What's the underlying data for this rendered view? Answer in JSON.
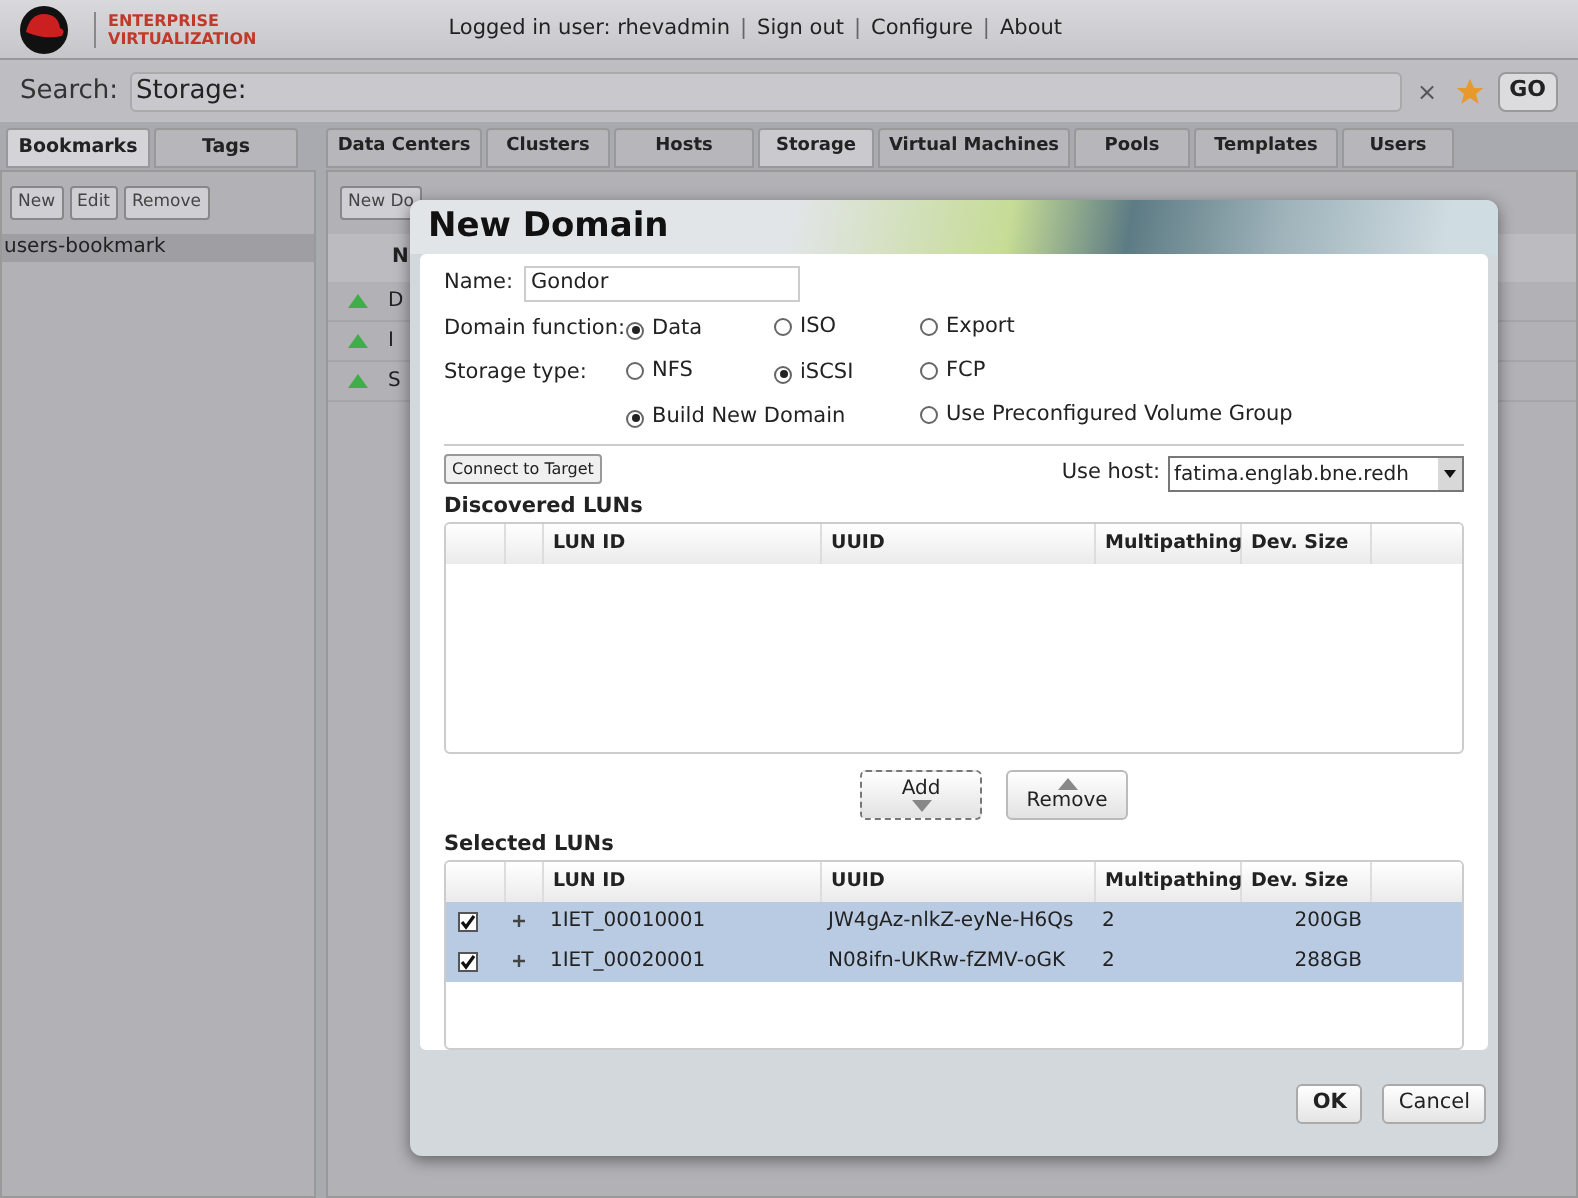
{
  "header": {
    "logo_line1": "ENTERPRISE",
    "logo_line2": "VIRTUALIZATION",
    "items": [
      {
        "kind": "text",
        "text": "Logged in user: rhevadmin"
      },
      {
        "kind": "separator",
        "text": "|"
      },
      {
        "kind": "link",
        "text": "Sign out"
      },
      {
        "kind": "separator",
        "text": "|"
      },
      {
        "kind": "link",
        "text": "Configure"
      },
      {
        "kind": "separator",
        "text": "|"
      },
      {
        "kind": "link",
        "text": "About"
      }
    ]
  },
  "search": {
    "label": "Search:",
    "value": "Storage:",
    "clear": "×",
    "button": "GO"
  },
  "left_tabs": [
    {
      "label": "Bookmarks",
      "selected": true
    },
    {
      "label": "Tags",
      "selected": false
    }
  ],
  "bookmark_buttons": [
    "New",
    "Edit",
    "Remove"
  ],
  "bookmarks": [
    {
      "label": "users-bookmark",
      "selected": true
    }
  ],
  "main_tabs": [
    {
      "label": "Data Centers",
      "selected": false
    },
    {
      "label": "Clusters",
      "selected": false
    },
    {
      "label": "Hosts",
      "selected": false
    },
    {
      "label": "Storage",
      "selected": true
    },
    {
      "label": "Virtual Machines",
      "selected": false
    },
    {
      "label": "Pools",
      "selected": false
    },
    {
      "label": "Templates",
      "selected": false
    },
    {
      "label": "Users",
      "selected": false
    }
  ],
  "background_list": {
    "toolbar_button": "New Do",
    "column": "N",
    "rows": [
      {
        "text": "D"
      },
      {
        "text": "I"
      },
      {
        "text": "S"
      }
    ]
  },
  "dialog": {
    "title": "New Domain",
    "name": {
      "label": "Name:",
      "value": "Gondor"
    },
    "radio_rows": [
      {
        "label": "Domain function:",
        "options": [
          {
            "label": "Data",
            "selected": true
          },
          {
            "label": "ISO",
            "selected": false
          },
          {
            "label": "Export",
            "selected": false
          }
        ]
      },
      {
        "label": "Storage type:",
        "options": [
          {
            "label": "NFS",
            "selected": false
          },
          {
            "label": "iSCSI",
            "selected": true
          },
          {
            "label": "FCP",
            "selected": false
          }
        ]
      },
      {
        "options": [
          {
            "label": "Build New Domain",
            "selected": true
          },
          {
            "label": "Use Preconfigured Volume Group",
            "selected": false
          }
        ]
      }
    ],
    "connect_button": "Connect to Target",
    "use_host": {
      "label": "Use host:",
      "value": "fatima.englab.bne.redh"
    },
    "discovered": {
      "title": "Discovered LUNs",
      "columns": [
        "LUN ID",
        "UUID",
        "Multipathing",
        "Dev. Size"
      ]
    },
    "add_button": "Add",
    "remove_button": "Remove",
    "selected_luns": {
      "title": "Selected LUNs",
      "columns": [
        "LUN ID",
        "UUID",
        "Multipathing",
        "Dev. Size"
      ],
      "rows": [
        {
          "checked": true,
          "selected": true,
          "lun_id": "1IET_00010001",
          "uuid": "JW4gAz-nlkZ-eyNe-H6Qs",
          "multipathing": "2",
          "dev_size": "200GB"
        },
        {
          "checked": true,
          "selected": true,
          "lun_id": "1IET_00020001",
          "uuid": "N08ifn-UKRw-fZMV-oGK",
          "multipathing": "2",
          "dev_size": "288GB"
        }
      ]
    },
    "buttons": [
      {
        "label": "OK",
        "default": true
      },
      {
        "label": "Cancel",
        "default": false
      }
    ]
  }
}
